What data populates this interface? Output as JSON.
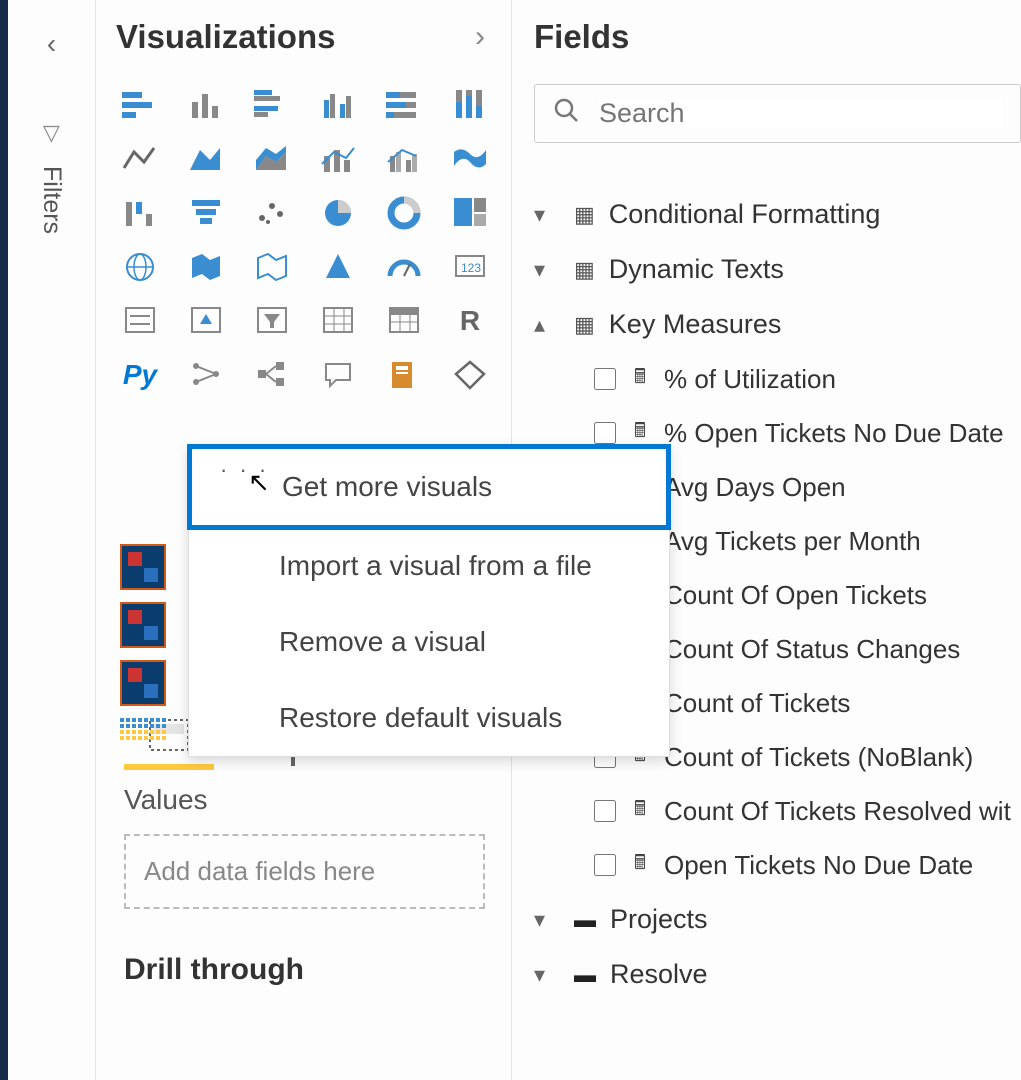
{
  "rail": {
    "filters_label": "Filters"
  },
  "viz_pane": {
    "title": "Visualizations"
  },
  "context_menu": {
    "get_more": "Get more visuals",
    "import_file": "Import a visual from a file",
    "remove": "Remove a visual",
    "restore": "Restore default visuals"
  },
  "config": {
    "values_label": "Values",
    "placeholder": "Add data fields here",
    "drill_label": "Drill through"
  },
  "fields_pane": {
    "title": "Fields",
    "search_placeholder": "Search"
  },
  "tables": {
    "t0": {
      "name": "Conditional Formatting"
    },
    "t1": {
      "name": "Dynamic Texts"
    },
    "t2": {
      "name": "Key Measures",
      "fields": {
        "f0": "% of Utilization",
        "f1": "% Open Tickets No Due Date",
        "f2": "Avg Days Open",
        "f3": "Avg Tickets per Month",
        "f4": "Count Of Open Tickets",
        "f5": "Count Of Status Changes",
        "f6": "Count of Tickets",
        "f7": "Count of Tickets (NoBlank)",
        "f8": "Count Of Tickets Resolved wit",
        "f9": "Open Tickets No Due Date"
      }
    },
    "t3": {
      "name": "Projects"
    },
    "t4": {
      "name": "Resolve"
    }
  }
}
